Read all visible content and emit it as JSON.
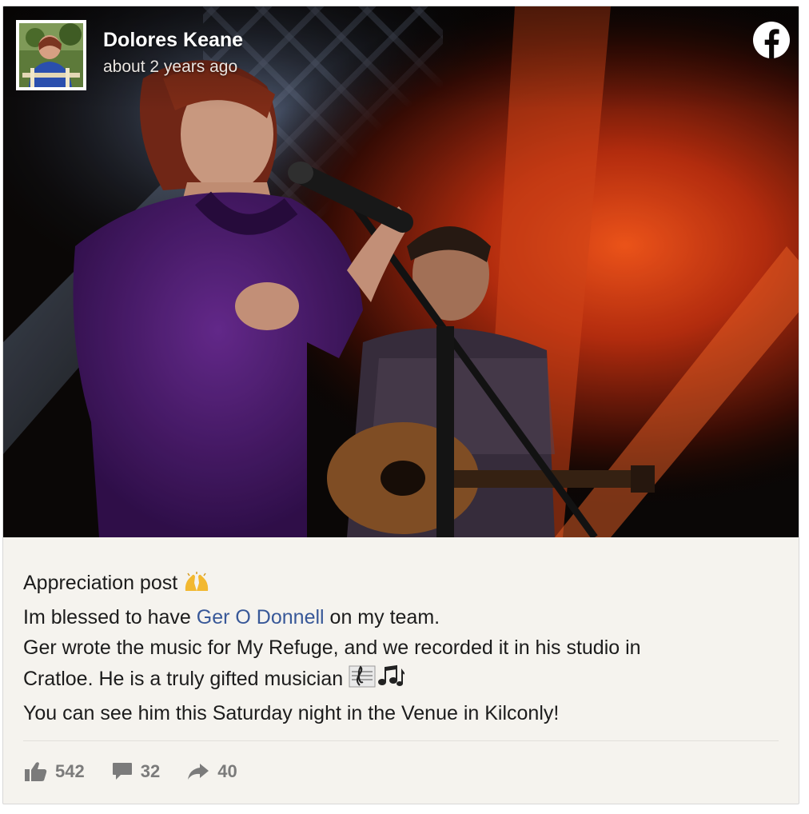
{
  "post": {
    "author": "Dolores Keane",
    "timestamp": "about 2 years ago",
    "platform_icon": "facebook-icon",
    "caption": {
      "line1": "Appreciation post",
      "line1_emoji": "raised-hands",
      "line2_before": "Im blessed to have ",
      "mention": "Ger O Donnell",
      "line2_after": " on my team.",
      "line3": "Ger wrote the music for My Refuge, and we recorded it in his studio in",
      "line4": "Cratloe. He is a truly gifted musician",
      "line4_emoji": "musical-score-notes",
      "line5": "You can see him this Saturday night in the Venue in Kilconly!"
    },
    "stats": {
      "likes": "542",
      "comments": "32",
      "shares": "40"
    }
  },
  "colors": {
    "card_bg": "#f5f3ee",
    "mention": "#385898",
    "stats_text": "#7b7b7b"
  }
}
